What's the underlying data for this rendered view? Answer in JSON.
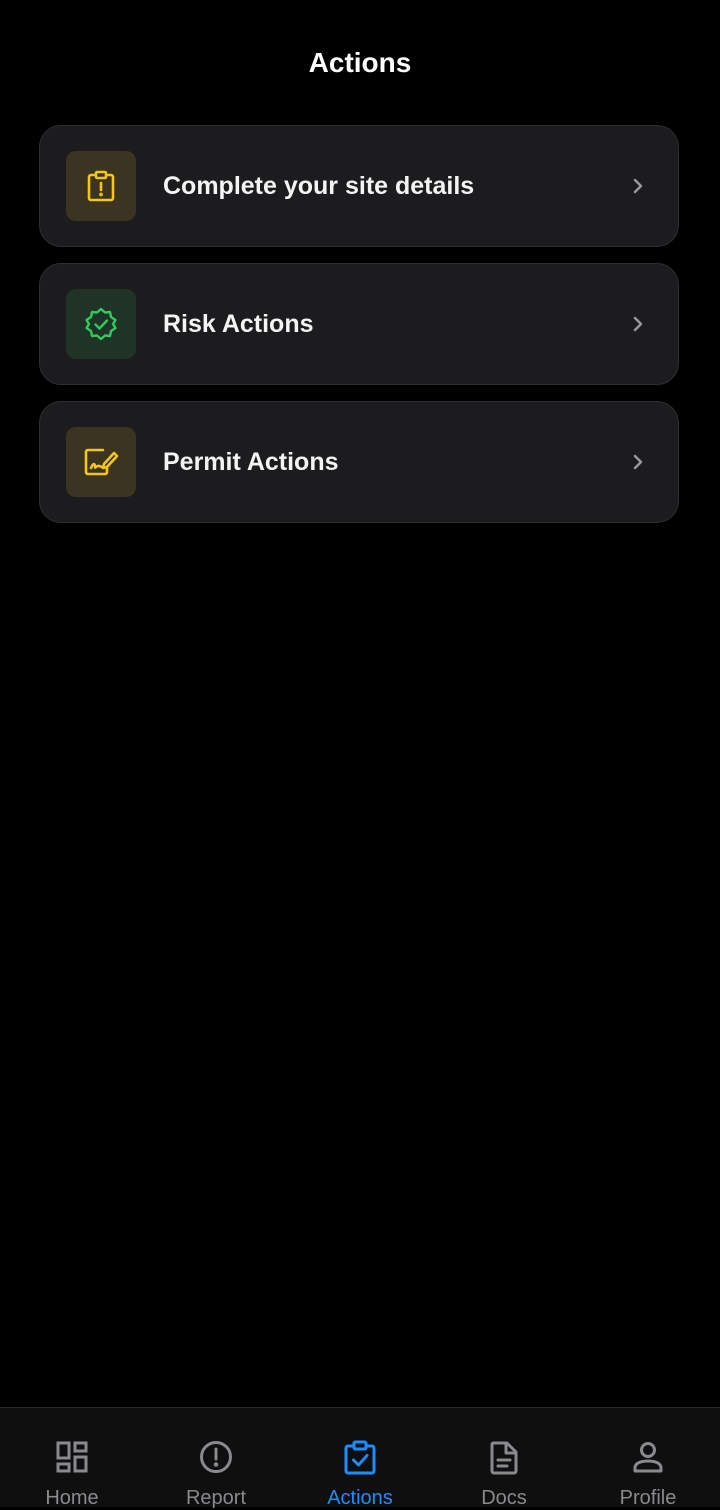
{
  "header": {
    "title": "Actions"
  },
  "action_cards": [
    {
      "label": "Complete your site details",
      "icon": "clipboard-alert-icon",
      "icon_color": "#f5c518",
      "icon_bg": "#3a3420"
    },
    {
      "label": "Risk Actions",
      "icon": "verified-badge-icon",
      "icon_color": "#2ecc5a",
      "icon_bg": "#1f3326"
    },
    {
      "label": "Permit Actions",
      "icon": "document-sign-icon",
      "icon_color": "#f5c518",
      "icon_bg": "#3a3420"
    }
  ],
  "tab_bar": {
    "active_tab": "Actions",
    "active_color": "#1f8bff",
    "inactive_color": "#8a8a8e",
    "tabs": [
      {
        "label": "Home",
        "icon": "dashboard-grid-icon"
      },
      {
        "label": "Report",
        "icon": "alert-circle-icon"
      },
      {
        "label": "Actions",
        "icon": "clipboard-check-icon"
      },
      {
        "label": "Docs",
        "icon": "document-icon"
      },
      {
        "label": "Profile",
        "icon": "person-icon"
      }
    ]
  }
}
